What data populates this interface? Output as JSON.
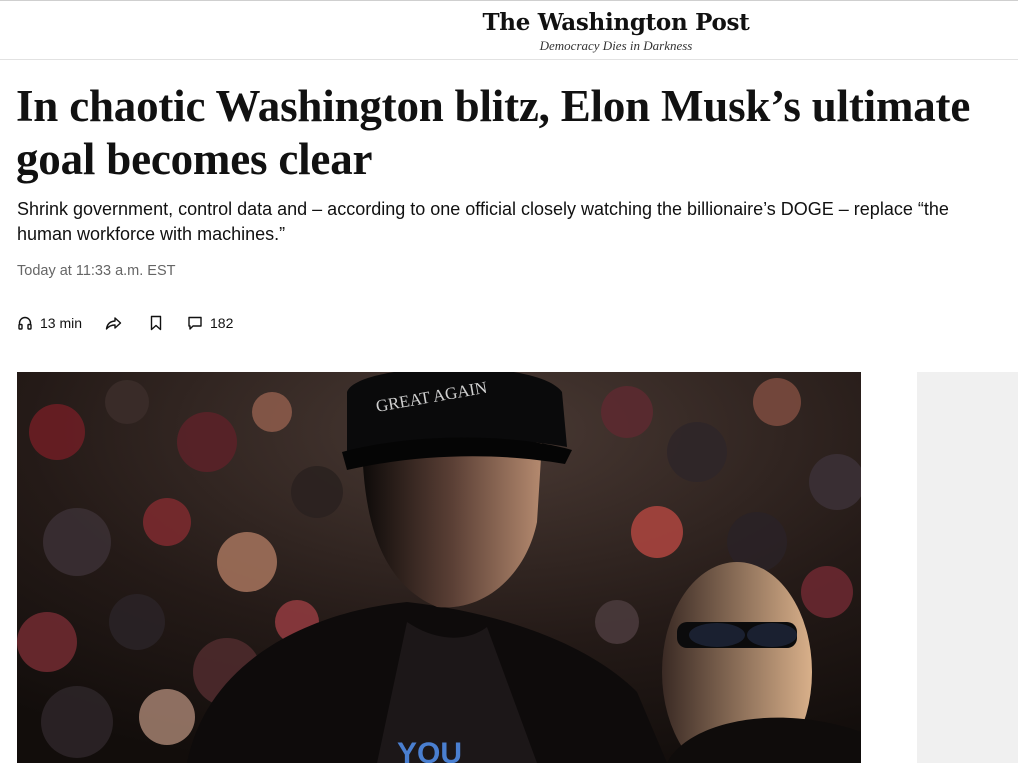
{
  "masthead": {
    "logo": "The Washington Post",
    "tagline": "Democracy Dies in Darkness"
  },
  "article": {
    "headline": "In chaotic Washington blitz, Elon Musk’s ultimate goal becomes clear",
    "dek": "Shrink government, control data and – according to one official closely watching the billionaire’s DOGE – replace “the human workforce with machines.”",
    "timestamp": "Today at 11:33 a.m. EST"
  },
  "actions": {
    "listen": {
      "icon": "headphones-icon",
      "label": "13 min"
    },
    "share": {
      "icon": "share-arrow-icon"
    },
    "save": {
      "icon": "bookmark-icon"
    },
    "comments": {
      "icon": "comment-icon",
      "label": "182"
    }
  },
  "hero_image": {
    "cap_text": "GREAT AGAIN",
    "shirt_text": "YOU"
  },
  "colors": {
    "text": "#111111",
    "muted": "#666666",
    "ad_background": "#f0f0f0"
  }
}
